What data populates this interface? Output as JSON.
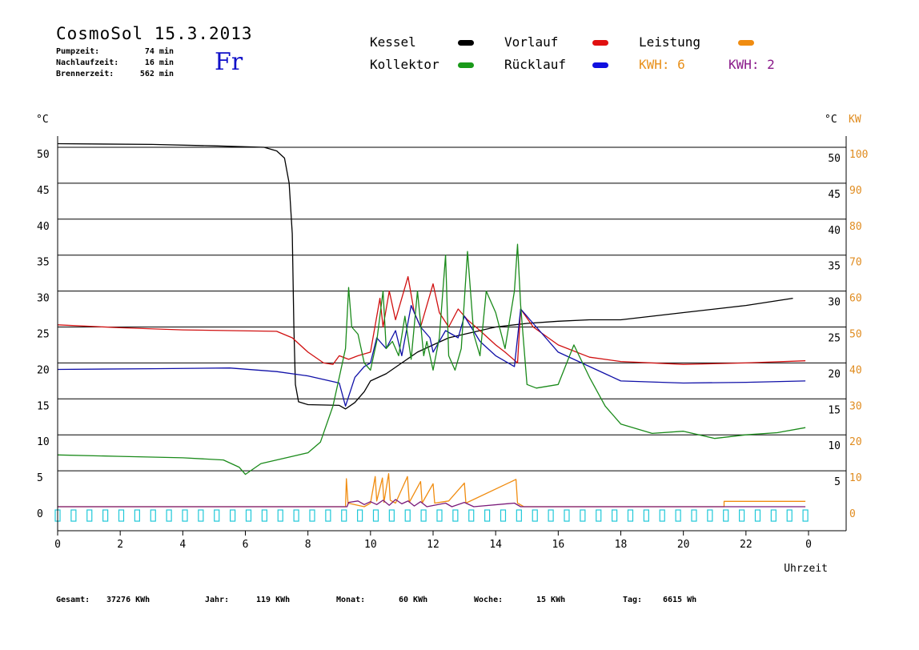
{
  "header": {
    "title": "CosmoSol 15.3.2013",
    "weekday": "Fr",
    "stats": [
      {
        "label": "Pumpzeit:",
        "value": "74 min"
      },
      {
        "label": "Nachlaufzeit:",
        "value": "16 min"
      },
      {
        "label": "Brennerzeit:",
        "value": "562 min"
      }
    ]
  },
  "legend": {
    "kessel": {
      "label": "Kessel",
      "color": "#000000"
    },
    "kollektor": {
      "label": "Kollektor",
      "color": "#1a9a1a"
    },
    "vorlauf": {
      "label": "Vorlauf",
      "color": "#e01010"
    },
    "ruecklauf": {
      "label": "Rücklauf",
      "color": "#1010e0"
    },
    "leistung": {
      "label": "Leistung",
      "color": "#f08c10"
    },
    "kwh1": {
      "label": "KWH: 6",
      "color": "#f08c10"
    },
    "kwh2": {
      "label": "KWH: 2",
      "color": "#8a1a8a"
    }
  },
  "footer": [
    {
      "label": "Gesamt:",
      "value": "37276 KWh"
    },
    {
      "label": "Jahr:",
      "value": "119 KWh"
    },
    {
      "label": "Monat:",
      "value": "60 KWh"
    },
    {
      "label": "Woche:",
      "value": "15 KWh"
    },
    {
      "label": "Tag:",
      "value": "6615 Wh"
    }
  ],
  "chart_data": {
    "type": "line",
    "xlabel": "Uhrzeit",
    "ylabel_left": "°C",
    "ylabel_right": "°C",
    "ylabel_right2": "KW",
    "xlim": [
      0,
      24
    ],
    "ylim": [
      0,
      50
    ],
    "x_ticks": [
      "0",
      "2",
      "4",
      "6",
      "8",
      "10",
      "12",
      "14",
      "16",
      "18",
      "20",
      "22",
      "0"
    ],
    "y_ticks_left": [
      "0",
      "5",
      "10",
      "15",
      "20",
      "25",
      "30",
      "35",
      "40",
      "45",
      "50"
    ],
    "y_ticks_right": [
      "5",
      "10",
      "15",
      "20",
      "25",
      "30",
      "35",
      "40",
      "45",
      "50"
    ],
    "y_ticks_kw": [
      "0",
      "10",
      "20",
      "30",
      "40",
      "50",
      "60",
      "70",
      "80",
      "90",
      "100"
    ],
    "grid": true,
    "colors": {
      "grid": "#000000",
      "axis": "#000000",
      "kw_ticks": "#e08c20",
      "status": "#20c8d8"
    },
    "series": [
      {
        "name": "Kessel",
        "color": "#000000",
        "points": [
          [
            0,
            50.5
          ],
          [
            3,
            50.4
          ],
          [
            5,
            50.2
          ],
          [
            6.6,
            50
          ],
          [
            7.0,
            49.5
          ],
          [
            7.25,
            48.5
          ],
          [
            7.4,
            45
          ],
          [
            7.5,
            38
          ],
          [
            7.55,
            25
          ],
          [
            7.6,
            17
          ],
          [
            7.7,
            14.6
          ],
          [
            8.0,
            14.2
          ],
          [
            9.0,
            14.1
          ],
          [
            9.2,
            13.6
          ],
          [
            9.5,
            14.5
          ],
          [
            9.8,
            16
          ],
          [
            10.0,
            17.5
          ],
          [
            10.5,
            18.5
          ],
          [
            11.0,
            20
          ],
          [
            11.5,
            21.5
          ],
          [
            12.0,
            22.5
          ],
          [
            12.5,
            23.5
          ],
          [
            13.0,
            24
          ],
          [
            13.5,
            24.5
          ],
          [
            14.0,
            25
          ],
          [
            14.6,
            25.3
          ],
          [
            15.0,
            25.5
          ],
          [
            16.0,
            25.8
          ],
          [
            17.0,
            26
          ],
          [
            18.0,
            26
          ],
          [
            20.0,
            27
          ],
          [
            22.0,
            28
          ],
          [
            23.5,
            29
          ]
        ]
      },
      {
        "name": "Vorlauf",
        "color": "#d01010",
        "points": [
          [
            0,
            25.3
          ],
          [
            2,
            24.9
          ],
          [
            4,
            24.6
          ],
          [
            7.0,
            24.4
          ],
          [
            7.5,
            23.5
          ],
          [
            8.0,
            21.5
          ],
          [
            8.5,
            20
          ],
          [
            8.8,
            19.8
          ],
          [
            9.0,
            21
          ],
          [
            9.3,
            20.5
          ],
          [
            9.6,
            21
          ],
          [
            10.0,
            21.5
          ],
          [
            10.3,
            29
          ],
          [
            10.4,
            25
          ],
          [
            10.6,
            30
          ],
          [
            10.8,
            26
          ],
          [
            11.2,
            32
          ],
          [
            11.4,
            27
          ],
          [
            11.6,
            25
          ],
          [
            12.0,
            31
          ],
          [
            12.2,
            27
          ],
          [
            12.5,
            25
          ],
          [
            12.8,
            27.5
          ],
          [
            13.1,
            26
          ],
          [
            13.5,
            24.5
          ],
          [
            14.0,
            22.5
          ],
          [
            14.3,
            21.5
          ],
          [
            14.7,
            20
          ],
          [
            14.8,
            27.5
          ],
          [
            15.2,
            25
          ],
          [
            16.0,
            22.5
          ],
          [
            17.0,
            20.8
          ],
          [
            18.0,
            20.2
          ],
          [
            20.0,
            19.8
          ],
          [
            22.0,
            20
          ],
          [
            23.9,
            20.3
          ]
        ]
      },
      {
        "name": "Rücklauf",
        "color": "#1010a8",
        "points": [
          [
            0,
            19.1
          ],
          [
            3,
            19.2
          ],
          [
            5.5,
            19.3
          ],
          [
            7.0,
            18.8
          ],
          [
            8.0,
            18.2
          ],
          [
            9.0,
            17.2
          ],
          [
            9.2,
            14
          ],
          [
            9.5,
            18
          ],
          [
            9.8,
            19.5
          ],
          [
            10.0,
            20
          ],
          [
            10.2,
            23.5
          ],
          [
            10.5,
            22
          ],
          [
            10.8,
            24.5
          ],
          [
            11.0,
            21
          ],
          [
            11.3,
            28
          ],
          [
            11.6,
            25
          ],
          [
            11.9,
            23.5
          ],
          [
            12.0,
            21.5
          ],
          [
            12.4,
            24.5
          ],
          [
            12.8,
            23.5
          ],
          [
            13.0,
            26.5
          ],
          [
            13.5,
            23
          ],
          [
            14.0,
            21
          ],
          [
            14.6,
            19.5
          ],
          [
            14.8,
            27.5
          ],
          [
            15.5,
            24
          ],
          [
            16.0,
            21.5
          ],
          [
            17.0,
            19.5
          ],
          [
            18.0,
            17.5
          ],
          [
            20.0,
            17.2
          ],
          [
            22.0,
            17.3
          ],
          [
            23.9,
            17.5
          ]
        ]
      },
      {
        "name": "Kollektor",
        "color": "#1a8a1a",
        "points": [
          [
            0,
            7.2
          ],
          [
            2,
            7
          ],
          [
            4,
            6.8
          ],
          [
            5.3,
            6.5
          ],
          [
            5.8,
            5.5
          ],
          [
            6.0,
            4.5
          ],
          [
            6.5,
            6
          ],
          [
            7.5,
            7
          ],
          [
            8.0,
            7.5
          ],
          [
            8.4,
            9
          ],
          [
            8.8,
            14
          ],
          [
            9.0,
            18
          ],
          [
            9.2,
            22
          ],
          [
            9.3,
            30.5
          ],
          [
            9.4,
            25
          ],
          [
            9.6,
            24
          ],
          [
            9.8,
            20
          ],
          [
            10.0,
            19
          ],
          [
            10.2,
            23
          ],
          [
            10.4,
            30
          ],
          [
            10.5,
            22
          ],
          [
            10.7,
            23
          ],
          [
            10.9,
            21
          ],
          [
            11.1,
            26.5
          ],
          [
            11.3,
            20.5
          ],
          [
            11.5,
            30
          ],
          [
            11.7,
            21
          ],
          [
            11.8,
            23
          ],
          [
            12.0,
            19
          ],
          [
            12.2,
            23.5
          ],
          [
            12.4,
            35
          ],
          [
            12.5,
            21
          ],
          [
            12.7,
            19
          ],
          [
            12.9,
            22
          ],
          [
            13.1,
            35.5
          ],
          [
            13.3,
            24
          ],
          [
            13.5,
            21
          ],
          [
            13.7,
            30
          ],
          [
            14.0,
            27
          ],
          [
            14.3,
            22
          ],
          [
            14.6,
            30
          ],
          [
            14.7,
            36.5
          ],
          [
            14.8,
            28
          ],
          [
            15.0,
            17
          ],
          [
            15.3,
            16.5
          ],
          [
            16.0,
            17
          ],
          [
            16.5,
            22.5
          ],
          [
            17.0,
            18
          ],
          [
            17.5,
            14
          ],
          [
            18.0,
            11.5
          ],
          [
            19.0,
            10.2
          ],
          [
            20.0,
            10.5
          ],
          [
            21.0,
            9.5
          ],
          [
            22.0,
            10
          ],
          [
            23.0,
            10.3
          ],
          [
            23.9,
            11
          ]
        ]
      },
      {
        "name": "Leistung",
        "color": "#f08c10",
        "points": [
          [
            0,
            0
          ],
          [
            9.2,
            0
          ],
          [
            9.23,
            3.9
          ],
          [
            9.28,
            0.5
          ],
          [
            9.8,
            0
          ],
          [
            10.0,
            0.5
          ],
          [
            10.15,
            4.2
          ],
          [
            10.2,
            0.8
          ],
          [
            10.38,
            4
          ],
          [
            10.43,
            0.6
          ],
          [
            10.58,
            4.6
          ],
          [
            10.63,
            0.9
          ],
          [
            10.8,
            0.5
          ],
          [
            11.18,
            4.2
          ],
          [
            11.24,
            0.6
          ],
          [
            11.6,
            3.5
          ],
          [
            11.65,
            0.5
          ],
          [
            12.0,
            3.2
          ],
          [
            12.05,
            0.5
          ],
          [
            12.5,
            0.8
          ],
          [
            13.0,
            3.3
          ],
          [
            13.05,
            0.5
          ],
          [
            14.65,
            3.8
          ],
          [
            14.7,
            0.5
          ],
          [
            14.9,
            0
          ],
          [
            21.3,
            0
          ],
          [
            21.3,
            0.75
          ],
          [
            23.9,
            0.75
          ]
        ]
      },
      {
        "name": "KWH",
        "color": "#7a1a7a",
        "points": [
          [
            0,
            0
          ],
          [
            9.25,
            0
          ],
          [
            9.3,
            0.6
          ],
          [
            9.6,
            0.8
          ],
          [
            9.8,
            0.3
          ],
          [
            10.0,
            0.7
          ],
          [
            10.2,
            0.3
          ],
          [
            10.4,
            0.9
          ],
          [
            10.6,
            0.2
          ],
          [
            10.8,
            1
          ],
          [
            11.0,
            0.4
          ],
          [
            11.2,
            0.8
          ],
          [
            11.4,
            0.1
          ],
          [
            11.6,
            0.7
          ],
          [
            11.8,
            0
          ],
          [
            12.4,
            0.5
          ],
          [
            12.6,
            0
          ],
          [
            13.0,
            0.6
          ],
          [
            13.3,
            0
          ],
          [
            14.6,
            0.5
          ],
          [
            14.8,
            0
          ],
          [
            23.9,
            0
          ]
        ]
      }
    ],
    "status_markers": {
      "color": "#20c8d8",
      "count": 48,
      "ranges": [
        [
          0,
          23.9
        ]
      ]
    }
  }
}
